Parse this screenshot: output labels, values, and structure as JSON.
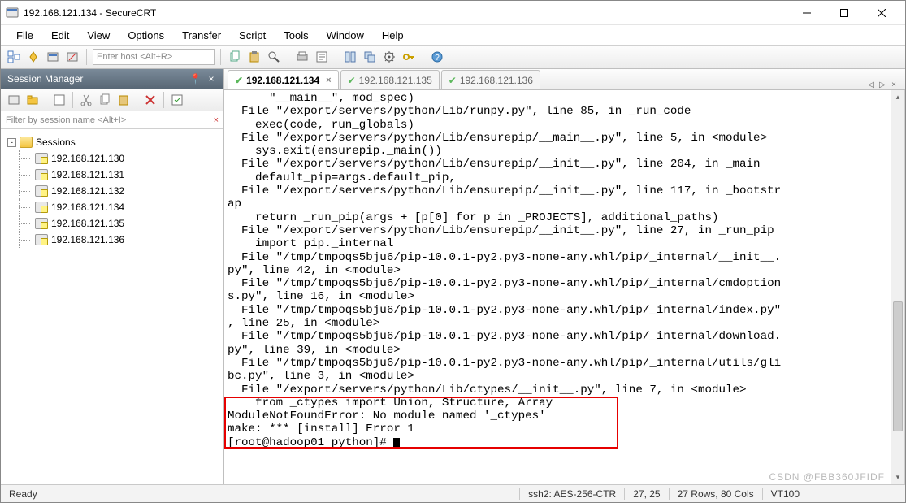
{
  "window": {
    "title": "192.168.121.134 - SecureCRT"
  },
  "menu": [
    "File",
    "Edit",
    "View",
    "Options",
    "Transfer",
    "Script",
    "Tools",
    "Window",
    "Help"
  ],
  "toolbar": {
    "host_placeholder": "Enter host <Alt+R>"
  },
  "session_manager": {
    "title": "Session Manager",
    "filter_placeholder": "Filter by session name <Alt+I>",
    "root": "Sessions",
    "nodes": [
      "192.168.121.130",
      "192.168.121.131",
      "192.168.121.132",
      "192.168.121.134",
      "192.168.121.135",
      "192.168.121.136"
    ]
  },
  "tabs": [
    {
      "label": "192.168.121.134",
      "active": true,
      "closable": true
    },
    {
      "label": "192.168.121.135",
      "active": false,
      "closable": false
    },
    {
      "label": "192.168.121.136",
      "active": false,
      "closable": false
    }
  ],
  "terminal": {
    "lines": [
      "      \"__main__\", mod_spec)",
      "  File \"/export/servers/python/Lib/runpy.py\", line 85, in _run_code",
      "    exec(code, run_globals)",
      "  File \"/export/servers/python/Lib/ensurepip/__main__.py\", line 5, in <module>",
      "    sys.exit(ensurepip._main())",
      "  File \"/export/servers/python/Lib/ensurepip/__init__.py\", line 204, in _main",
      "    default_pip=args.default_pip,",
      "  File \"/export/servers/python/Lib/ensurepip/__init__.py\", line 117, in _bootstr",
      "ap",
      "    return _run_pip(args + [p[0] for p in _PROJECTS], additional_paths)",
      "  File \"/export/servers/python/Lib/ensurepip/__init__.py\", line 27, in _run_pip",
      "    import pip._internal",
      "  File \"/tmp/tmpoqs5bju6/pip-10.0.1-py2.py3-none-any.whl/pip/_internal/__init__.",
      "py\", line 42, in <module>",
      "  File \"/tmp/tmpoqs5bju6/pip-10.0.1-py2.py3-none-any.whl/pip/_internal/cmdoption",
      "s.py\", line 16, in <module>",
      "  File \"/tmp/tmpoqs5bju6/pip-10.0.1-py2.py3-none-any.whl/pip/_internal/index.py\"",
      ", line 25, in <module>",
      "  File \"/tmp/tmpoqs5bju6/pip-10.0.1-py2.py3-none-any.whl/pip/_internal/download.",
      "py\", line 39, in <module>",
      "  File \"/tmp/tmpoqs5bju6/pip-10.0.1-py2.py3-none-any.whl/pip/_internal/utils/gli",
      "bc.py\", line 3, in <module>",
      "  File \"/export/servers/python/Lib/ctypes/__init__.py\", line 7, in <module>",
      "    from _ctypes import Union, Structure, Array",
      "ModuleNotFoundError: No module named '_ctypes'",
      "make: *** [install] Error 1",
      "[root@hadoop01 python]# "
    ]
  },
  "status": {
    "ready": "Ready",
    "cipher": "ssh2: AES-256-CTR",
    "cursor": "27, 25",
    "size": "27 Rows, 80 Cols",
    "term": "VT100"
  },
  "watermark": "CSDN @FBB360JFIDF"
}
